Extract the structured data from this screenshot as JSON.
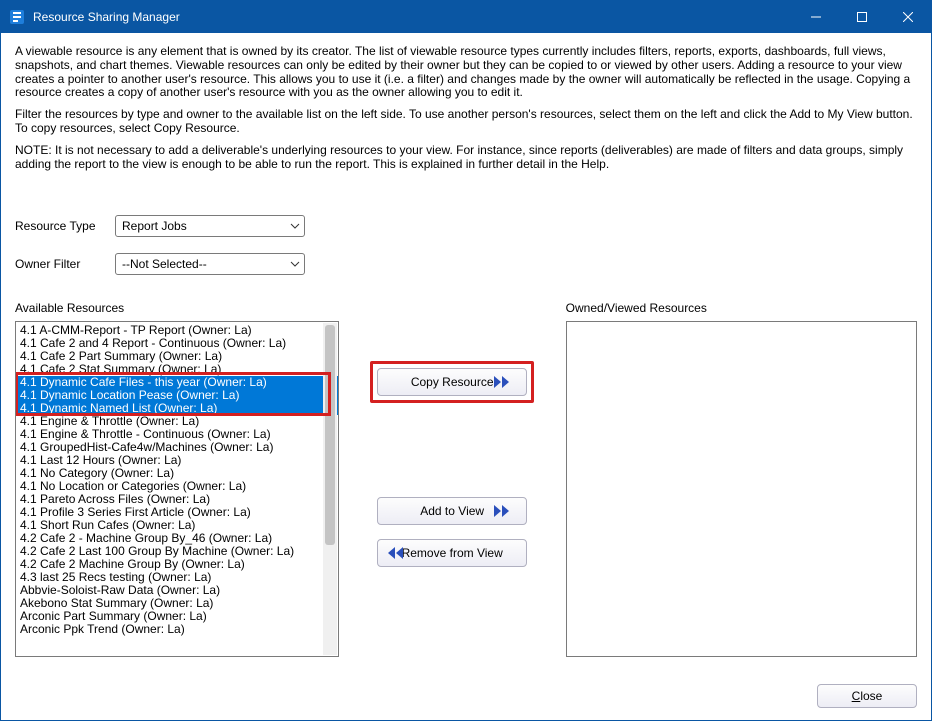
{
  "titlebar": {
    "title": "Resource Sharing Manager"
  },
  "description": {
    "p1": "A viewable resource is any element that is owned by its creator. The list of viewable resource types currently includes filters, reports, exports, dashboards, full views, snapshots, and chart themes. Viewable resources can only be edited by their owner but they can be copied to or viewed by other users. Adding a resource to your view creates a pointer to another user's resource. This allows you to use it (i.e. a filter) and changes made by the owner will automatically be reflected in the usage. Copying a resource creates a copy of another user's resource with you as the owner allowing you to edit it.",
    "p2": "Filter the resources by type and owner to the available list on the left side. To use another person's resources, select them on the left and click the Add to My View button. To copy resources, select Copy Resource.",
    "p3": "NOTE: It is not necessary to add a deliverable's underlying resources to your view. For instance, since reports (deliverables) are made of filters and data groups, simply adding the report to the view is enough to be able to run the report. This is explained in further detail in the Help."
  },
  "filters": {
    "resourceType": {
      "label": "Resource Type",
      "value": "Report Jobs"
    },
    "ownerFilter": {
      "label": "Owner Filter",
      "value": "--Not Selected--"
    }
  },
  "availableLabel": "Available Resources",
  "ownedLabel": "Owned/Viewed Resources",
  "buttons": {
    "copy": "Copy Resource",
    "add": "Add to View",
    "remove": "Remove from View",
    "close": "Close"
  },
  "availableItems": [
    {
      "text": "4.1 A-CMM-Report - TP Report (Owner: La)",
      "selected": false
    },
    {
      "text": "4.1 Cafe 2 and 4 Report - Continuous (Owner: La)",
      "selected": false
    },
    {
      "text": "4.1 Cafe 2 Part Summary (Owner: La)",
      "selected": false
    },
    {
      "text": "4.1 Cafe 2 Stat Summary (Owner: La)",
      "selected": false
    },
    {
      "text": "4.1 Dynamic Cafe Files - this year (Owner: La)",
      "selected": true
    },
    {
      "text": "4.1 Dynamic Location Pease (Owner: La)",
      "selected": true
    },
    {
      "text": "4.1 Dynamic Named List (Owner: La)",
      "selected": true
    },
    {
      "text": "4.1 Engine & Throttle (Owner: La)",
      "selected": false
    },
    {
      "text": "4.1 Engine & Throttle - Continuous (Owner: La)",
      "selected": false
    },
    {
      "text": "4.1 GroupedHist-Cafe4w/Machines (Owner: La)",
      "selected": false
    },
    {
      "text": "4.1 Last 12 Hours (Owner: La)",
      "selected": false
    },
    {
      "text": "4.1 No Category (Owner: La)",
      "selected": false
    },
    {
      "text": "4.1 No Location or Categories (Owner: La)",
      "selected": false
    },
    {
      "text": "4.1 Pareto Across Files (Owner: La)",
      "selected": false
    },
    {
      "text": "4.1 Profile 3 Series First Article (Owner: La)",
      "selected": false
    },
    {
      "text": "4.1 Short Run Cafes (Owner: La)",
      "selected": false
    },
    {
      "text": "4.2 Cafe 2 - Machine Group By_46 (Owner: La)",
      "selected": false
    },
    {
      "text": "4.2 Cafe 2 Last 100 Group By Machine (Owner: La)",
      "selected": false
    },
    {
      "text": "4.2 Cafe 2 Machine Group By (Owner: La)",
      "selected": false
    },
    {
      "text": "4.3 last 25 Recs testing (Owner: La)",
      "selected": false
    },
    {
      "text": "Abbvie-Soloist-Raw Data (Owner: La)",
      "selected": false
    },
    {
      "text": "Akebono Stat Summary (Owner: La)",
      "selected": false
    },
    {
      "text": "Arconic Part Summary (Owner: La)",
      "selected": false
    },
    {
      "text": "Arconic Ppk Trend (Owner: La)",
      "selected": false
    }
  ]
}
